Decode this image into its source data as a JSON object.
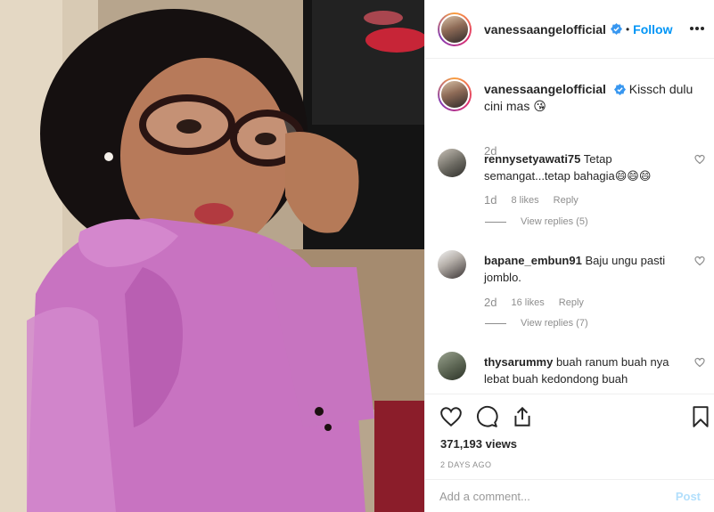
{
  "post": {
    "username": "vanessaangelofficial",
    "follow_label": "Follow",
    "dot": "•"
  },
  "caption": {
    "username": "vanessaangelofficial",
    "text": "Kissch dulu cini mas 😘",
    "time": "2d"
  },
  "comments": [
    {
      "username": "rennysetyawati75",
      "text": "Tetap semangat...tetap bahagia😄😄😄",
      "time": "1d",
      "likes": "8 likes",
      "reply_label": "Reply",
      "view_replies": "View replies (5)"
    },
    {
      "username": "bapane_embun91",
      "text": "Baju ungu pasti jomblo.",
      "time": "2d",
      "likes": "16 likes",
      "reply_label": "Reply",
      "view_replies": "View replies (7)"
    },
    {
      "username": "thysarummy",
      "text": "buah ranum buah nya lebat buah kedondong buah"
    }
  ],
  "stats": {
    "views": "371,193 views",
    "posted": "2 DAYS AGO"
  },
  "add_comment": {
    "placeholder": "Add a comment...",
    "post_label": "Post"
  },
  "colors": {
    "accent": "#0095f6",
    "verified": "#3897f0",
    "post_disabled": "#b2dffc",
    "muted": "#8e8e8e",
    "dress": "#c96fc0"
  },
  "icons": [
    "verified-badge-icon",
    "more-options-icon",
    "heart-icon",
    "comment-icon",
    "share-icon",
    "bookmark-icon"
  ]
}
